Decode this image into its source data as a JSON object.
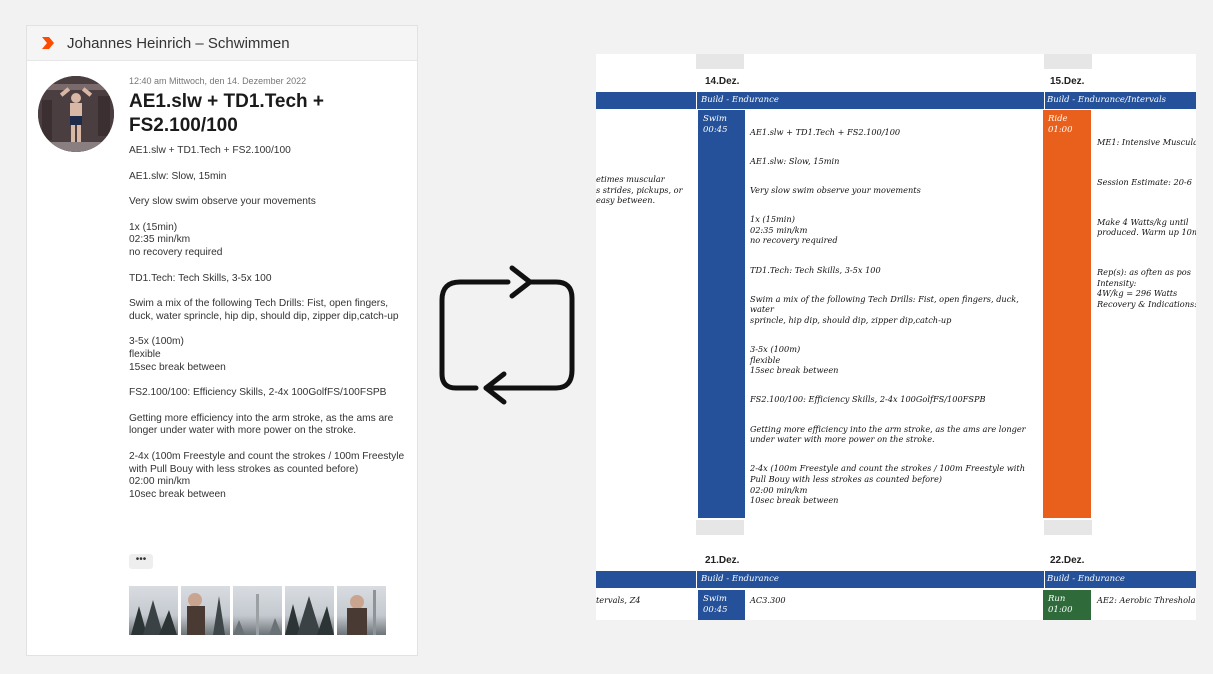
{
  "post": {
    "athlete_name": "Johannes Heinrich – Schwimmen",
    "timestamp": "12:40 am Mittwoch, den 14. Dezember 2022",
    "title": "AE1.slw + TD1.Tech + FS2.100/100",
    "description": [
      "AE1.slw + TD1.Tech + FS2.100/100",
      "AE1.slw: Slow, 15min",
      "Very slow swim observe your movements",
      "1x (15min)\n02:35 min/km\nno recovery required",
      "TD1.Tech: Tech Skills, 3-5x 100",
      "Swim a mix of the following Tech Drills: Fist, open fingers, duck, water sprincle, hip dip, should dip, zipper dip,catch-up",
      "3-5x (100m)\nflexible\n15sec break between",
      "FS2.100/100: Efficiency Skills, 2-4x 100GolfFS/100FSPB",
      "Getting more efficiency into the arm stroke, as the ams are longer under water with more power on the stroke.",
      "2-4x (100m Freestyle and count the strokes / 100m Freestyle with Pull Bouy with less strokes as counted before)\n02:00 min/km\n10sec break between"
    ],
    "more_label": "•••",
    "brand_color": "#fc4c02"
  },
  "calendar": {
    "week1": {
      "date_a": "14.Dez.",
      "date_b": "15.Dez.",
      "phase_a": "Build - Endurance",
      "phase_b": "Build - Endurance/Intervals",
      "prev_text": "etimes muscular\ns strides, pickups, or\neasy between.",
      "swim": {
        "sport": "Swim",
        "duration": "00:45",
        "color": "#24519a"
      },
      "swim_text": [
        "AE1.slw + TD1.Tech + FS2.100/100",
        "AE1.slw: Slow, 15min",
        "Very slow swim observe your movements",
        "1x (15min)\n02:35 min/km\nno recovery required",
        "TD1.Tech: Tech Skills, 3-5x 100",
        "Swim a mix of the following Tech Drills: Fist, open fingers, duck, water\nsprincle, hip dip, should dip, zipper dip,catch-up",
        "3-5x (100m)\nflexible\n15sec break between",
        "FS2.100/100: Efficiency Skills, 2-4x 100GolfFS/100FSPB",
        "Getting more efficiency into the arm stroke, as the ams are longer\nunder water with more power on the stroke.",
        "2-4x (100m Freestyle and count the strokes / 100m Freestyle with\nPull Bouy with less strokes as counted before)\n02:00 min/km\n10sec break between"
      ],
      "ride": {
        "sport": "Ride",
        "duration": "01:00",
        "color": "#e8601c"
      },
      "ride_text": [
        "ME1: Intensive Muscula",
        "Session Estimate: 20-6",
        "Make 4 Watts/kg until\nproduced. Warm up 10m",
        "Rep(s): as often as pos\nIntensity:\n4W/kg = 296 Watts\nRecovery & Indications:"
      ]
    },
    "week2": {
      "date_a": "21.Dez.",
      "date_b": "22.Dez.",
      "phase_a": "Build - Endurance",
      "phase_b": "Build - Endurance",
      "prev_text": "tervals, Z4",
      "swim": {
        "sport": "Swim",
        "duration": "00:45",
        "color": "#24519a"
      },
      "swim_text": "AC3.300",
      "run": {
        "sport": "Run",
        "duration": "01:00",
        "color": "#2f6b3a"
      },
      "run_text": "AE2: Aerobic Threshola"
    }
  }
}
